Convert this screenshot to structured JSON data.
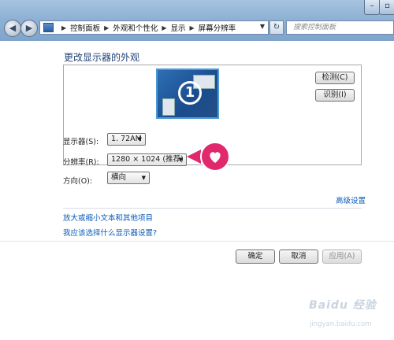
{
  "window": {
    "controls": {
      "minimize": "–",
      "maximize": "▫"
    },
    "accent": "#7fa4cb"
  },
  "nav": {
    "breadcrumb": [
      "控制面板",
      "外观和个性化",
      "显示",
      "屏幕分辨率"
    ],
    "search_placeholder": "搜索控制面板"
  },
  "page": {
    "title": "更改显示器的外观",
    "preview_monitor_number": "1",
    "detect_label": "检测(C)",
    "identify_label": "识别(I)",
    "fields": {
      "display": {
        "label": "显示器(S):",
        "value": "1. 72AM"
      },
      "resolution": {
        "label": "分辨率(R):",
        "value": "1280 × 1024 (推荐)"
      },
      "orientation": {
        "label": "方向(O):",
        "value": "横向"
      }
    },
    "advanced_link": "高级设置",
    "links": [
      "放大或缩小文本和其他项目",
      "我应该选择什么显示器设置?"
    ],
    "buttons": {
      "ok": "确定",
      "cancel": "取消",
      "apply": "应用(A)"
    }
  },
  "watermark": {
    "logo": "Baidu 经验",
    "url": "jingyan.baidu.com"
  },
  "colors": {
    "callout": "#e0296c",
    "link": "#0b5bb8",
    "title": "#1f3f76"
  }
}
